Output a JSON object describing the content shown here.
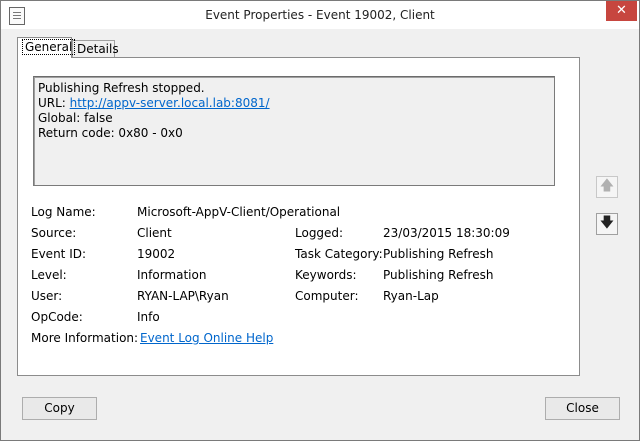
{
  "window": {
    "title": "Event Properties - Event 19002, Client",
    "close_glyph": "✕"
  },
  "tabs": [
    {
      "label": "General",
      "active": true
    },
    {
      "label": "Details",
      "active": false
    }
  ],
  "message": {
    "line1": "Publishing Refresh stopped.",
    "url_label": "URL: ",
    "url": "http://appv-server.local.lab:8081/",
    "line3": "Global: false",
    "line4": "Return code: 0x80 - 0x0"
  },
  "fields": {
    "log_name_label": "Log Name:",
    "log_name": "Microsoft-AppV-Client/Operational",
    "source_label": "Source:",
    "source": "Client",
    "logged_label": "Logged:",
    "logged": "23/03/2015 18:30:09",
    "event_id_label": "Event ID:",
    "event_id": "19002",
    "task_category_label": "Task Category:",
    "task_category": "Publishing Refresh",
    "level_label": "Level:",
    "level": "Information",
    "keywords_label": "Keywords:",
    "keywords": "Publishing Refresh",
    "user_label": "User:",
    "user": "RYAN-LAP\\Ryan",
    "computer_label": "Computer:",
    "computer": "Ryan-Lap",
    "opcode_label": "OpCode:",
    "opcode": "Info",
    "more_info_label": "More Information:",
    "more_info_link": "Event Log Online Help"
  },
  "nav": {
    "up_glyph": "🡅",
    "down_glyph": "🡇"
  },
  "buttons": {
    "copy": "Copy",
    "close": "Close"
  },
  "colors": {
    "link": "#0066cc",
    "close_button": "#c7463f"
  }
}
